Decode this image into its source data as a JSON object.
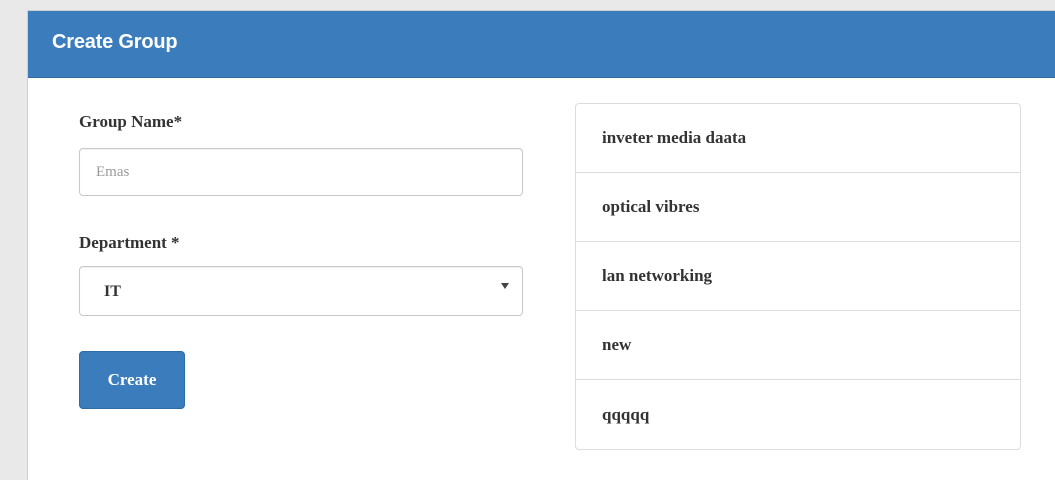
{
  "header": {
    "title": "Create Group"
  },
  "form": {
    "group_name_label": "Group Name*",
    "group_name_placeholder": "Emas",
    "department_label": "Department *",
    "department_value": "IT",
    "create_label": "Create"
  },
  "groups": {
    "items": [
      "inveter media daata",
      "optical vibres",
      "lan networking",
      "new",
      "qqqqq"
    ]
  },
  "colors": {
    "header_bg": "#3a7cbc",
    "button_bg": "#3a7cbc"
  }
}
